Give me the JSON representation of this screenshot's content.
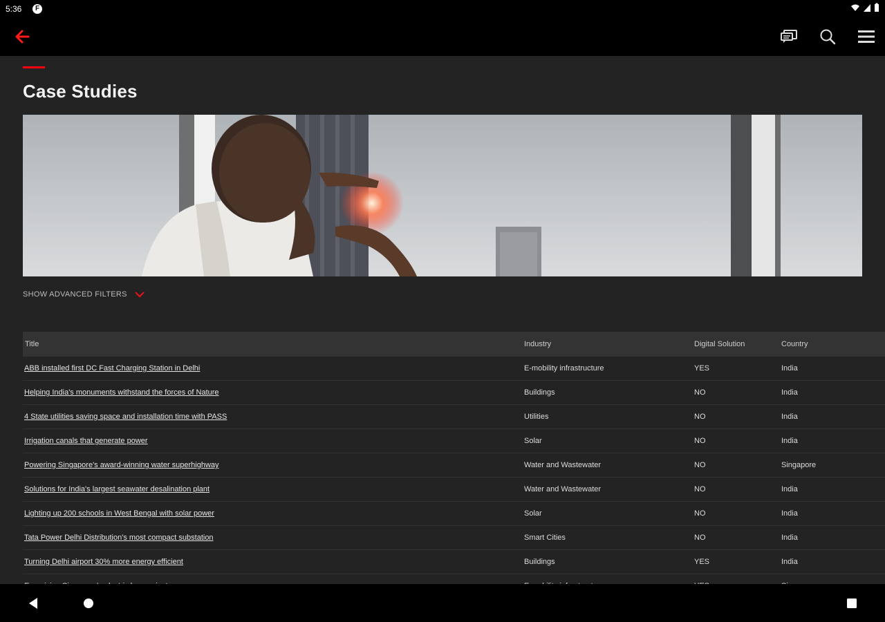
{
  "status_bar": {
    "time": "5:36",
    "app_icon_letter": "F"
  },
  "app_bar": {
    "back_icon": "arrow-left-icon",
    "actions": [
      "chat-icon",
      "search-icon",
      "menu-icon"
    ],
    "accent_color": "#ff000f"
  },
  "page": {
    "title": "Case Studies",
    "filters_label": "SHOW ADVANCED FILTERS"
  },
  "table": {
    "headers": {
      "title": "Title",
      "industry": "Industry",
      "digital": "Digital Solution",
      "country": "Country"
    },
    "rows": [
      {
        "title": "ABB installed first DC Fast Charging Station in Delhi",
        "industry": "E-mobility infrastructure",
        "digital": "YES",
        "country": "India"
      },
      {
        "title": "Helping India's monuments withstand the forces of Nature",
        "industry": "Buildings",
        "digital": "NO",
        "country": "India"
      },
      {
        "title": "4 State utilities saving space and installation time with PASS",
        "industry": "Utilities",
        "digital": "NO",
        "country": "India"
      },
      {
        "title": "Irrigation canals that generate power",
        "industry": "Solar",
        "digital": "NO",
        "country": "India"
      },
      {
        "title": "Powering Singapore's award-winning water superhighway",
        "industry": "Water and Wastewater",
        "digital": "NO",
        "country": "Singapore"
      },
      {
        "title": "Solutions for India's largest seawater desalination plant",
        "industry": "Water and Wastewater",
        "digital": "NO",
        "country": "India"
      },
      {
        "title": "Lighting up 200 schools in West Bengal with solar power",
        "industry": "Solar",
        "digital": "NO",
        "country": "India"
      },
      {
        "title": "Tata Power Delhi Distribution's most compact substation",
        "industry": "Smart Cities",
        "digital": "NO",
        "country": "India"
      },
      {
        "title": "Turning Delhi airport 30% more energy efficient",
        "industry": "Buildings",
        "digital": "YES",
        "country": "India"
      },
      {
        "title": "Energizing Singapore's electric bus project",
        "industry": "E-mobility infrastructure",
        "digital": "YES",
        "country": "Singapore"
      }
    ]
  }
}
